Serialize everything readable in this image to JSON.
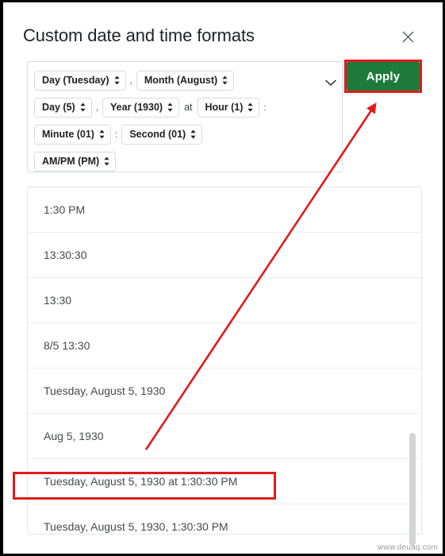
{
  "dialog": {
    "title": "Custom date and time formats",
    "close_icon": "close-icon"
  },
  "toolbar": {
    "apply_label": "Apply",
    "apply_bg_color": "#1d7a3b",
    "apply_text_color": "#ffffff"
  },
  "format_builder": {
    "expand_icon": "chevron-down-icon",
    "chips": [
      {
        "label": "Day (Tuesday)",
        "token": "day-name",
        "after": ","
      },
      {
        "label": "Month (August)",
        "token": "month-name",
        "after": ""
      },
      {
        "label": "Day (5)",
        "token": "day-number",
        "after": ","
      },
      {
        "label": "Year (1930)",
        "token": "year",
        "after": ""
      },
      {
        "label": "Hour (1)",
        "token": "hour",
        "after": ":"
      },
      {
        "label": "Minute (01)",
        "token": "minute",
        "after": ":"
      },
      {
        "label": "Second (01)",
        "token": "second",
        "after": ""
      },
      {
        "label": "AM/PM (PM)",
        "token": "ampm",
        "after": ""
      }
    ],
    "connector_word": "at",
    "rows": [
      {
        "items": [
          "Day (Tuesday)",
          ",",
          "Month (August)"
        ]
      },
      {
        "items": [
          "Day (5)",
          ",",
          "Year (1930)",
          "at",
          "Hour (1)",
          ":"
        ]
      },
      {
        "items": [
          "Minute (01)",
          ":",
          "Second (01)"
        ]
      },
      {
        "items": [
          "AM/PM (PM)"
        ]
      }
    ]
  },
  "preset_list": {
    "items": [
      {
        "label": "1:30 PM",
        "highlighted": false
      },
      {
        "label": "13:30:30",
        "highlighted": false
      },
      {
        "label": "13:30",
        "highlighted": false
      },
      {
        "label": "8/5 13:30",
        "highlighted": false
      },
      {
        "label": "Tuesday, August 5, 1930",
        "highlighted": false
      },
      {
        "label": "Aug 5, 1930",
        "highlighted": false
      },
      {
        "label": "Tuesday, August 5, 1930 at 1:30:30 PM",
        "highlighted": true
      },
      {
        "label": "Tuesday, August 5, 1930, 1:30:30 PM",
        "highlighted": false
      }
    ]
  },
  "annotations": {
    "highlight_color": "#e01b1b",
    "arrow_from": "Tuesday, August 5, 1930 at 1:30:30 PM",
    "arrow_to": "Apply"
  },
  "watermark": {
    "text": "www.deuaq.com"
  }
}
